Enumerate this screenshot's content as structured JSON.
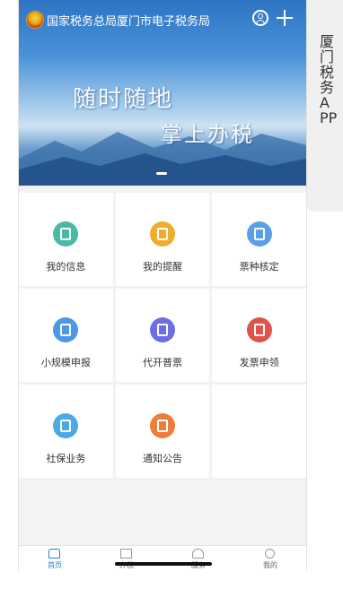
{
  "header": {
    "org_title": "国家税务总局厦门市电子税务局",
    "slogan_line1": "随时随地",
    "slogan_line2": "掌上办税"
  },
  "side_label": "厦门税务APP",
  "grid": [
    {
      "label": "我的信息",
      "icon": "user-icon",
      "color": "#4bb9a5"
    },
    {
      "label": "我的提醒",
      "icon": "reminder-icon",
      "color": "#efac2d"
    },
    {
      "label": "票种核定",
      "icon": "ticket-check-icon",
      "color": "#5b9fe8"
    },
    {
      "label": "小规模申报",
      "icon": "send-icon",
      "color": "#4c97e6"
    },
    {
      "label": "代开普票",
      "icon": "invoice-icon",
      "color": "#6c6fe2"
    },
    {
      "label": "发票申领",
      "icon": "invoice-apply-icon",
      "color": "#e0534a"
    },
    {
      "label": "社保业务",
      "icon": "monitor-icon",
      "color": "#4aa9e6"
    },
    {
      "label": "通知公告",
      "icon": "bell-icon",
      "color": "#ec7d3a"
    }
  ],
  "tabs": [
    {
      "label": "首页",
      "icon": "home-icon",
      "active": true
    },
    {
      "label": "办税",
      "icon": "list-icon",
      "active": false
    },
    {
      "label": "服务",
      "icon": "heart-icon",
      "active": false
    },
    {
      "label": "我的",
      "icon": "person-icon",
      "active": false
    }
  ],
  "colors": {
    "accent": "#2a7fd4"
  }
}
